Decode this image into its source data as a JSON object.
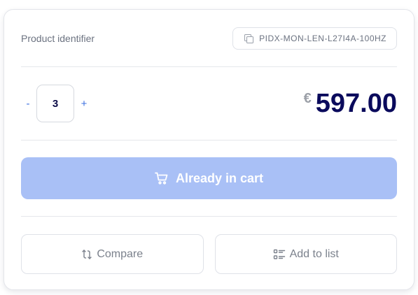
{
  "product": {
    "identifier_label": "Product identifier",
    "identifier_value": "PIDX-MON-LEN-L27I4A-100HZ"
  },
  "quantity": {
    "decrement_label": "-",
    "value": "3",
    "increment_label": "+"
  },
  "price": {
    "currency_symbol": "€",
    "amount": "597.00"
  },
  "cart_button": {
    "label": "Already in cart",
    "icon": "cart-icon",
    "state": "disabled"
  },
  "actions": {
    "compare_label": "Compare",
    "compare_icon": "compare-icon",
    "add_to_list_label": "Add to list",
    "add_to_list_icon": "list-icon"
  },
  "colors": {
    "accent": "#3b6fe0",
    "cart_button_bg": "#a9c0f6",
    "price_text": "#0a0a5c",
    "muted_text": "#6b7280"
  }
}
